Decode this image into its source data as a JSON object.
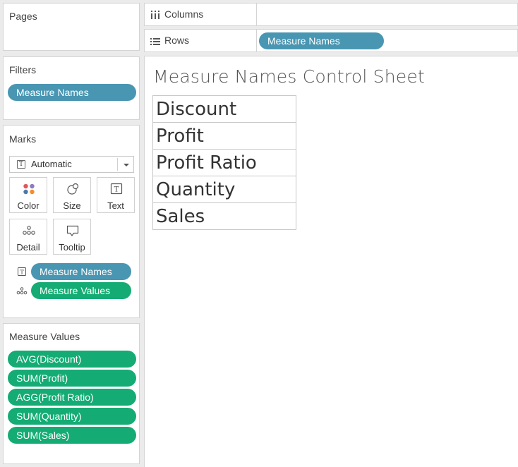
{
  "pages": {
    "title": "Pages"
  },
  "filters": {
    "title": "Filters",
    "pills": [
      "Measure Names"
    ]
  },
  "marks": {
    "title": "Marks",
    "mark_type": "Automatic",
    "buttons": [
      {
        "label": "Color",
        "icon": "color-dots-icon"
      },
      {
        "label": "Size",
        "icon": "size-shapes-icon"
      },
      {
        "label": "Text",
        "icon": "text-box-icon"
      },
      {
        "label": "Detail",
        "icon": "detail-dots-icon"
      },
      {
        "label": "Tooltip",
        "icon": "tooltip-bubble-icon"
      }
    ],
    "fields": [
      {
        "label": "Measure Names",
        "encoding": "text-icon",
        "color": "#4996b2"
      },
      {
        "label": "Measure Values",
        "encoding": "detail-icon",
        "color": "#14ac74"
      }
    ]
  },
  "measure_values": {
    "title": "Measure Values",
    "pills": [
      "AVG(Discount)",
      "SUM(Profit)",
      "AGG(Profit Ratio)",
      "SUM(Quantity)",
      "SUM(Sales)"
    ]
  },
  "columns_shelf": {
    "label": "Columns",
    "pills": []
  },
  "rows_shelf": {
    "label": "Rows",
    "pills": [
      "Measure Names"
    ]
  },
  "view": {
    "title": "Measure Names Control Sheet",
    "rows": [
      "Discount",
      "Profit",
      "Profit Ratio",
      "Quantity",
      "Sales"
    ]
  },
  "colors": {
    "dimension_pill": "#4996b2",
    "measure_pill": "#14ac74",
    "panel_bg": "#ffffff",
    "app_bg": "#ebebeb"
  }
}
